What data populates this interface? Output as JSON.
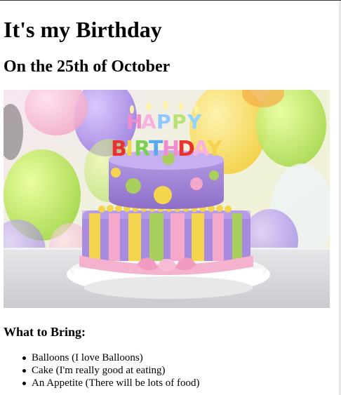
{
  "page": {
    "title": "It's my Birthday",
    "subtitle": "On the 25th of October",
    "image": {
      "subject": "birthday-cake",
      "candle_lettering": "HAPPY BIRTHDAY"
    },
    "bring_heading": "What to Bring:",
    "bring_items": [
      "Balloons (I love Balloons)",
      "Cake (I'm really good at eating)",
      "An Appetite (There will be lots of food)"
    ]
  },
  "colors": {
    "text": "#000000",
    "background": "#ffffff",
    "cake_purple": "#9b7fd0",
    "frosting_pink": "#f2a9c9",
    "accent_yellow": "#f4d44d",
    "accent_green": "#a9cf5c"
  }
}
